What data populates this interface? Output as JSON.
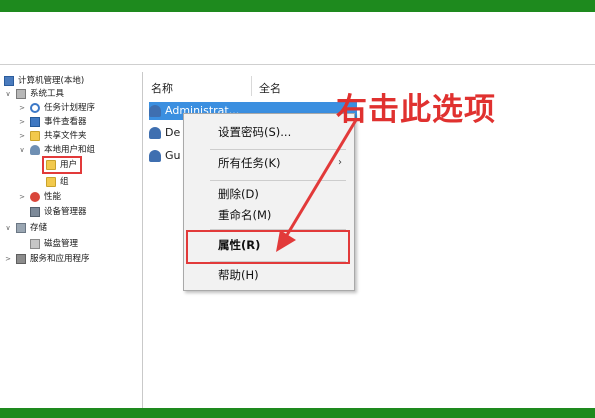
{
  "tree": {
    "items": [
      {
        "label": "计算机管理(本地)",
        "twisty": "",
        "icon": "computer-icon"
      },
      {
        "label": "系统工具",
        "twisty": "∨",
        "icon": "tools-icon"
      },
      {
        "label": "任务计划程序",
        "twisty": ">",
        "icon": "clock-icon"
      },
      {
        "label": "事件查看器",
        "twisty": ">",
        "icon": "event-log-icon"
      },
      {
        "label": "共享文件夹",
        "twisty": ">",
        "icon": "shared-folder-icon"
      },
      {
        "label": "本地用户和组",
        "twisty": "∨",
        "icon": "users-icon"
      },
      {
        "label": "用户",
        "twisty": "",
        "icon": "folder-icon"
      },
      {
        "label": "组",
        "twisty": "",
        "icon": "folder-icon"
      },
      {
        "label": "性能",
        "twisty": ">",
        "icon": "performance-icon"
      },
      {
        "label": "设备管理器",
        "twisty": "",
        "icon": "device-manager-icon"
      },
      {
        "label": "存储",
        "twisty": "∨",
        "icon": "storage-icon"
      },
      {
        "label": "磁盘管理",
        "twisty": "",
        "icon": "disk-icon"
      },
      {
        "label": "服务和应用程序",
        "twisty": ">",
        "icon": "services-icon"
      }
    ]
  },
  "list": {
    "columns": [
      "名称",
      "全名"
    ],
    "rows": [
      "Administrat...",
      "De",
      "Gu"
    ]
  },
  "context_menu": {
    "items": [
      "设置密码(S)...",
      "所有任务(K)",
      "删除(D)",
      "重命名(M)",
      "属性(R)",
      "帮助(H)"
    ],
    "submenu_chevron": "›"
  },
  "annotation": {
    "callout_text": "右击此选项",
    "color": "#e0312f"
  },
  "colors": {
    "frame_green": "#1e8a1e",
    "selection": "#3b8fe0",
    "annotation_red": "#e23a3a"
  }
}
